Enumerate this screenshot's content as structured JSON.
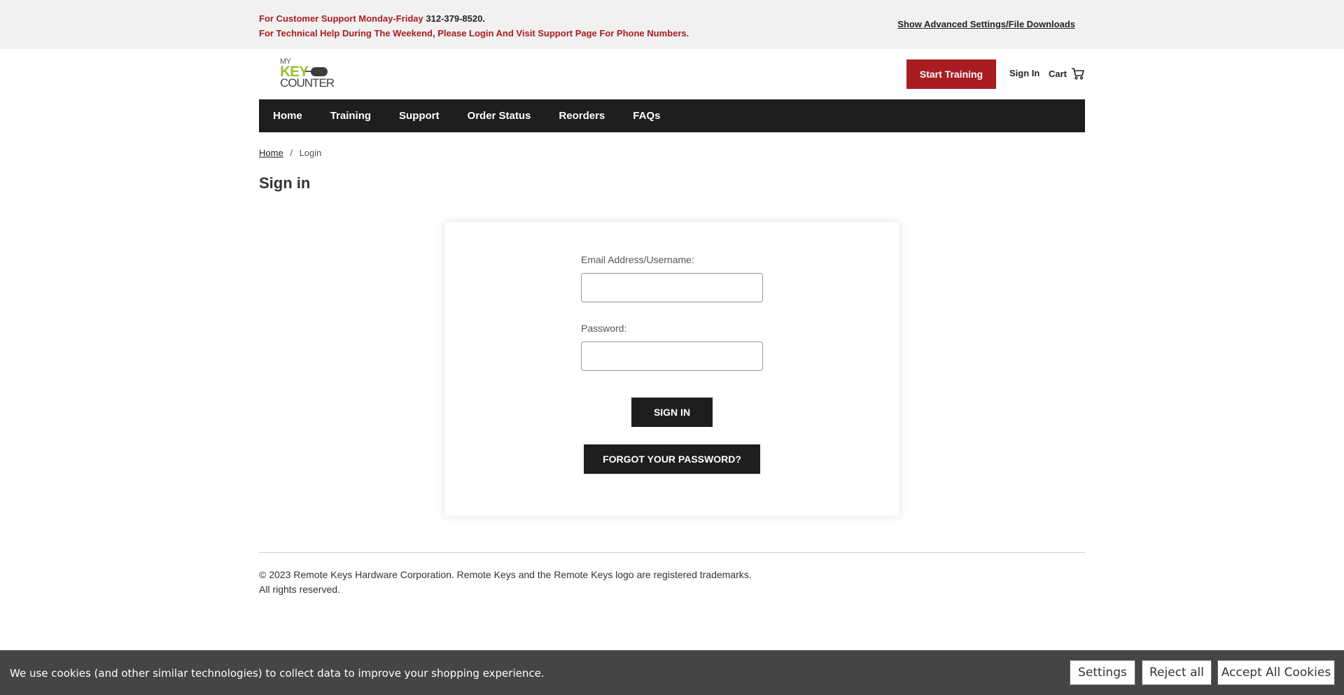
{
  "topbar": {
    "support_prefix": "For Customer Support Monday-Friday",
    "support_phone": "312-379-8520.",
    "weekend_text": "For Technical Help During The Weekend, Please Login And Visit Support Page For Phone Numbers.",
    "advanced_link": "Show Advanced Settings/File Downloads"
  },
  "logo": {
    "line1": "MY",
    "line2": "KEY",
    "line3": "COUNTER",
    "color": "#9bbf2f"
  },
  "header": {
    "start_training": "Start Training",
    "sign_in": "Sign In",
    "cart": "Cart",
    "accent_color": "#a81c22"
  },
  "nav": {
    "items": [
      {
        "label": "Home"
      },
      {
        "label": "Training"
      },
      {
        "label": "Support"
      },
      {
        "label": "Order Status"
      },
      {
        "label": "Reorders"
      },
      {
        "label": "FAQs"
      }
    ]
  },
  "breadcrumb": {
    "home": "Home",
    "separator": "/",
    "current": "Login"
  },
  "page": {
    "title": "Sign in"
  },
  "form": {
    "email_label": "Email Address/Username:",
    "email_value": "",
    "password_label": "Password:",
    "password_value": "",
    "sign_in_button": "SIGN IN",
    "forgot_button": "FORGOT YOUR PASSWORD?"
  },
  "footer": {
    "copyright": "© 2023 Remote Keys Hardware Corporation. Remote Keys and the Remote Keys logo are registered trademarks.",
    "rights": "All rights reserved."
  },
  "cookie": {
    "message": "We use cookies (and other similar technologies) to collect data to improve your shopping experience.",
    "settings": "Settings",
    "reject": "Reject all",
    "accept": "Accept All Cookies"
  }
}
